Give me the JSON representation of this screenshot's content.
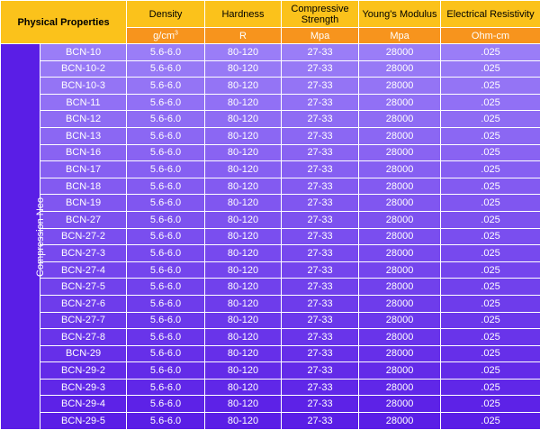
{
  "header": {
    "label": "Physical Properties",
    "columns": [
      {
        "name": "Density",
        "unit": "g/cm",
        "unit_sup": "3"
      },
      {
        "name": "Hardness",
        "unit": "R",
        "unit_sup": ""
      },
      {
        "name": "Compressive Strength",
        "unit": "Mpa",
        "unit_sup": ""
      },
      {
        "name": "Young's Modulus",
        "unit": "Mpa",
        "unit_sup": ""
      },
      {
        "name": "Electrical Resistivity",
        "unit": "Ohm-cm",
        "unit_sup": ""
      }
    ]
  },
  "group": {
    "label": "Compression Neo"
  },
  "rows": [
    {
      "model": "BCN-10",
      "density": "5.6-6.0",
      "hardness": "80-120",
      "compressive": "27-33",
      "youngs": "28000",
      "resistivity": ".025"
    },
    {
      "model": "BCN-10-2",
      "density": "5.6-6.0",
      "hardness": "80-120",
      "compressive": "27-33",
      "youngs": "28000",
      "resistivity": ".025"
    },
    {
      "model": "BCN-10-3",
      "density": "5.6-6.0",
      "hardness": "80-120",
      "compressive": "27-33",
      "youngs": "28000",
      "resistivity": ".025"
    },
    {
      "model": "BCN-11",
      "density": "5.6-6.0",
      "hardness": "80-120",
      "compressive": "27-33",
      "youngs": "28000",
      "resistivity": ".025"
    },
    {
      "model": "BCN-12",
      "density": "5.6-6.0",
      "hardness": "80-120",
      "compressive": "27-33",
      "youngs": "28000",
      "resistivity": ".025"
    },
    {
      "model": "BCN-13",
      "density": "5.6-6.0",
      "hardness": "80-120",
      "compressive": "27-33",
      "youngs": "28000",
      "resistivity": ".025"
    },
    {
      "model": "BCN-16",
      "density": "5.6-6.0",
      "hardness": "80-120",
      "compressive": "27-33",
      "youngs": "28000",
      "resistivity": ".025"
    },
    {
      "model": "BCN-17",
      "density": "5.6-6.0",
      "hardness": "80-120",
      "compressive": "27-33",
      "youngs": "28000",
      "resistivity": ".025"
    },
    {
      "model": "BCN-18",
      "density": "5.6-6.0",
      "hardness": "80-120",
      "compressive": "27-33",
      "youngs": "28000",
      "resistivity": ".025"
    },
    {
      "model": "BCN-19",
      "density": "5.6-6.0",
      "hardness": "80-120",
      "compressive": "27-33",
      "youngs": "28000",
      "resistivity": ".025"
    },
    {
      "model": "BCN-27",
      "density": "5.6-6.0",
      "hardness": "80-120",
      "compressive": "27-33",
      "youngs": "28000",
      "resistivity": ".025"
    },
    {
      "model": "BCN-27-2",
      "density": "5.6-6.0",
      "hardness": "80-120",
      "compressive": "27-33",
      "youngs": "28000",
      "resistivity": ".025"
    },
    {
      "model": "BCN-27-3",
      "density": "5.6-6.0",
      "hardness": "80-120",
      "compressive": "27-33",
      "youngs": "28000",
      "resistivity": ".025"
    },
    {
      "model": "BCN-27-4",
      "density": "5.6-6.0",
      "hardness": "80-120",
      "compressive": "27-33",
      "youngs": "28000",
      "resistivity": ".025"
    },
    {
      "model": "BCN-27-5",
      "density": "5.6-6.0",
      "hardness": "80-120",
      "compressive": "27-33",
      "youngs": "28000",
      "resistivity": ".025"
    },
    {
      "model": "BCN-27-6",
      "density": "5.6-6.0",
      "hardness": "80-120",
      "compressive": "27-33",
      "youngs": "28000",
      "resistivity": ".025"
    },
    {
      "model": "BCN-27-7",
      "density": "5.6-6.0",
      "hardness": "80-120",
      "compressive": "27-33",
      "youngs": "28000",
      "resistivity": ".025"
    },
    {
      "model": "BCN-27-8",
      "density": "5.6-6.0",
      "hardness": "80-120",
      "compressive": "27-33",
      "youngs": "28000",
      "resistivity": ".025"
    },
    {
      "model": "BCN-29",
      "density": "5.6-6.0",
      "hardness": "80-120",
      "compressive": "27-33",
      "youngs": "28000",
      "resistivity": ".025"
    },
    {
      "model": "BCN-29-2",
      "density": "5.6-6.0",
      "hardness": "80-120",
      "compressive": "27-33",
      "youngs": "28000",
      "resistivity": ".025"
    },
    {
      "model": "BCN-29-3",
      "density": "5.6-6.0",
      "hardness": "80-120",
      "compressive": "27-33",
      "youngs": "28000",
      "resistivity": ".025"
    },
    {
      "model": "BCN-29-4",
      "density": "5.6-6.0",
      "hardness": "80-120",
      "compressive": "27-33",
      "youngs": "28000",
      "resistivity": ".025"
    },
    {
      "model": "BCN-29-5",
      "density": "5.6-6.0",
      "hardness": "80-120",
      "compressive": "27-33",
      "youngs": "28000",
      "resistivity": ".025"
    }
  ],
  "colors": {
    "header_yellow": "#fbc21b",
    "header_orange": "#f7941d",
    "group_purple": "#5a1ee6",
    "row_gradient_start": "#9a7df7",
    "row_gradient_end": "#5a1ee6"
  }
}
